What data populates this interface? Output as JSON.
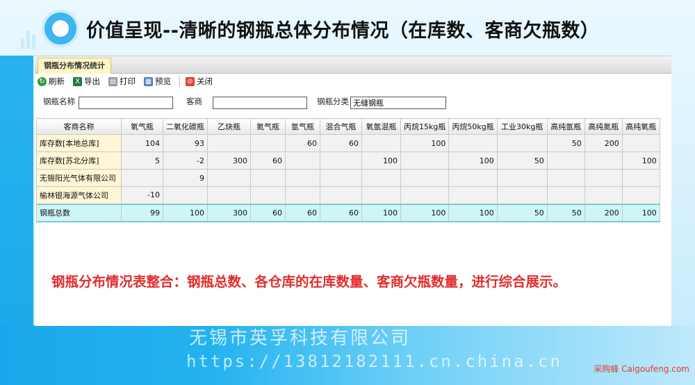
{
  "slide": {
    "title": "价值呈现--清晰的钢瓶总体分布情况（在库数、客商欠瓶数）",
    "summary": "钢瓶分布情况表整合：钢瓶总数、各仓库的在库数量、客商欠瓶数量，进行综合展示。",
    "watermark_company": "无锡市英孚科技有限公司",
    "watermark_url": "https://13812182111.cn.china.cn",
    "credit": "采购蜂 Caigoufeng.com"
  },
  "window": {
    "tab_label": "钢瓶分布情况统计",
    "toolbar": {
      "refresh": "刷新",
      "export": "导出",
      "print": "打印",
      "preview": "预览",
      "close": "关闭"
    },
    "filters": {
      "cylinder_name_label": "钢瓶名称",
      "cylinder_name_value": "",
      "merchant_label": "客商",
      "merchant_value": "",
      "category_label": "钢瓶分类",
      "category_value": "无缝钢瓶"
    }
  },
  "grid": {
    "columns": [
      "客商名称",
      "氧气瓶",
      "二氧化碳瓶",
      "乙炔瓶",
      "氮气瓶",
      "氩气瓶",
      "混合气瓶",
      "氧氩混瓶",
      "丙烷15kg瓶",
      "丙烷50kg瓶",
      "工业30kg瓶",
      "高纯氩瓶",
      "高纯氮瓶",
      "高纯氧瓶"
    ],
    "rows": [
      [
        "库存数[本地总库]",
        "104",
        "93",
        "",
        "",
        "60",
        "60",
        "",
        "100",
        "",
        "",
        "50",
        "200",
        ""
      ],
      [
        "库存数[苏北分库]",
        "5",
        "-2",
        "300",
        "60",
        "",
        "",
        "100",
        "",
        "100",
        "50",
        "",
        "",
        "100"
      ],
      [
        "无锡阳光气体有限公司",
        "",
        "9",
        "",
        "",
        "",
        "",
        "",
        "",
        "",
        "",
        "",
        "",
        ""
      ],
      [
        "榆林银海源气体公司",
        "-10",
        "",
        "",
        "",
        "",
        "",
        "",
        "",
        "",
        "",
        "",
        "",
        ""
      ]
    ],
    "total_row": [
      "钢瓶总数",
      "99",
      "100",
      "300",
      "60",
      "60",
      "60",
      "100",
      "100",
      "100",
      "50",
      "50",
      "200",
      "100"
    ]
  },
  "icons": {
    "refresh": "refresh-icon",
    "export": "excel-icon",
    "print": "printer-icon",
    "preview": "preview-icon",
    "close": "close-icon"
  }
}
